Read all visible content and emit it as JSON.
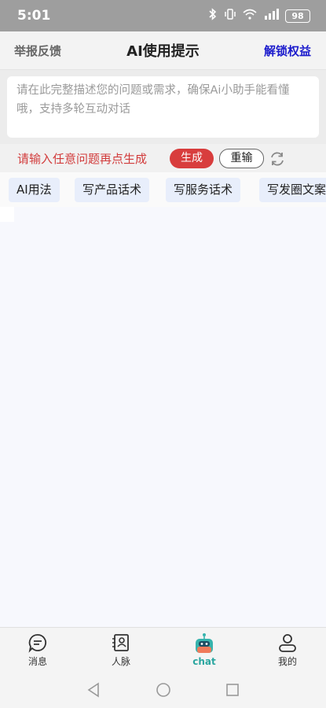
{
  "status": {
    "time": "5:01",
    "battery": "98"
  },
  "header": {
    "left": "举报反馈",
    "title": "AI使用提示",
    "right": "解锁权益"
  },
  "input": {
    "placeholder": "请在此完整描述您的问题或需求，确保Ai小助手能看懂哦，支持多轮互动对话",
    "value": ""
  },
  "actions": {
    "hint": "请输入任意问题再点生成",
    "generate": "生成",
    "reset": "重输"
  },
  "chips": [
    "AI用法",
    "写产品话术",
    "写服务话术",
    "写发圈文案"
  ],
  "tabs": [
    {
      "label": "消息",
      "icon": "message-icon"
    },
    {
      "label": "人脉",
      "icon": "contacts-icon"
    },
    {
      "label": "chat",
      "icon": "robot-icon",
      "active": true
    },
    {
      "label": "我的",
      "icon": "profile-icon"
    }
  ],
  "colors": {
    "accent": "#d83d3d",
    "link": "#1a1acc",
    "active_tab": "#2ba6a0",
    "chip_bg": "#e8eefb"
  }
}
